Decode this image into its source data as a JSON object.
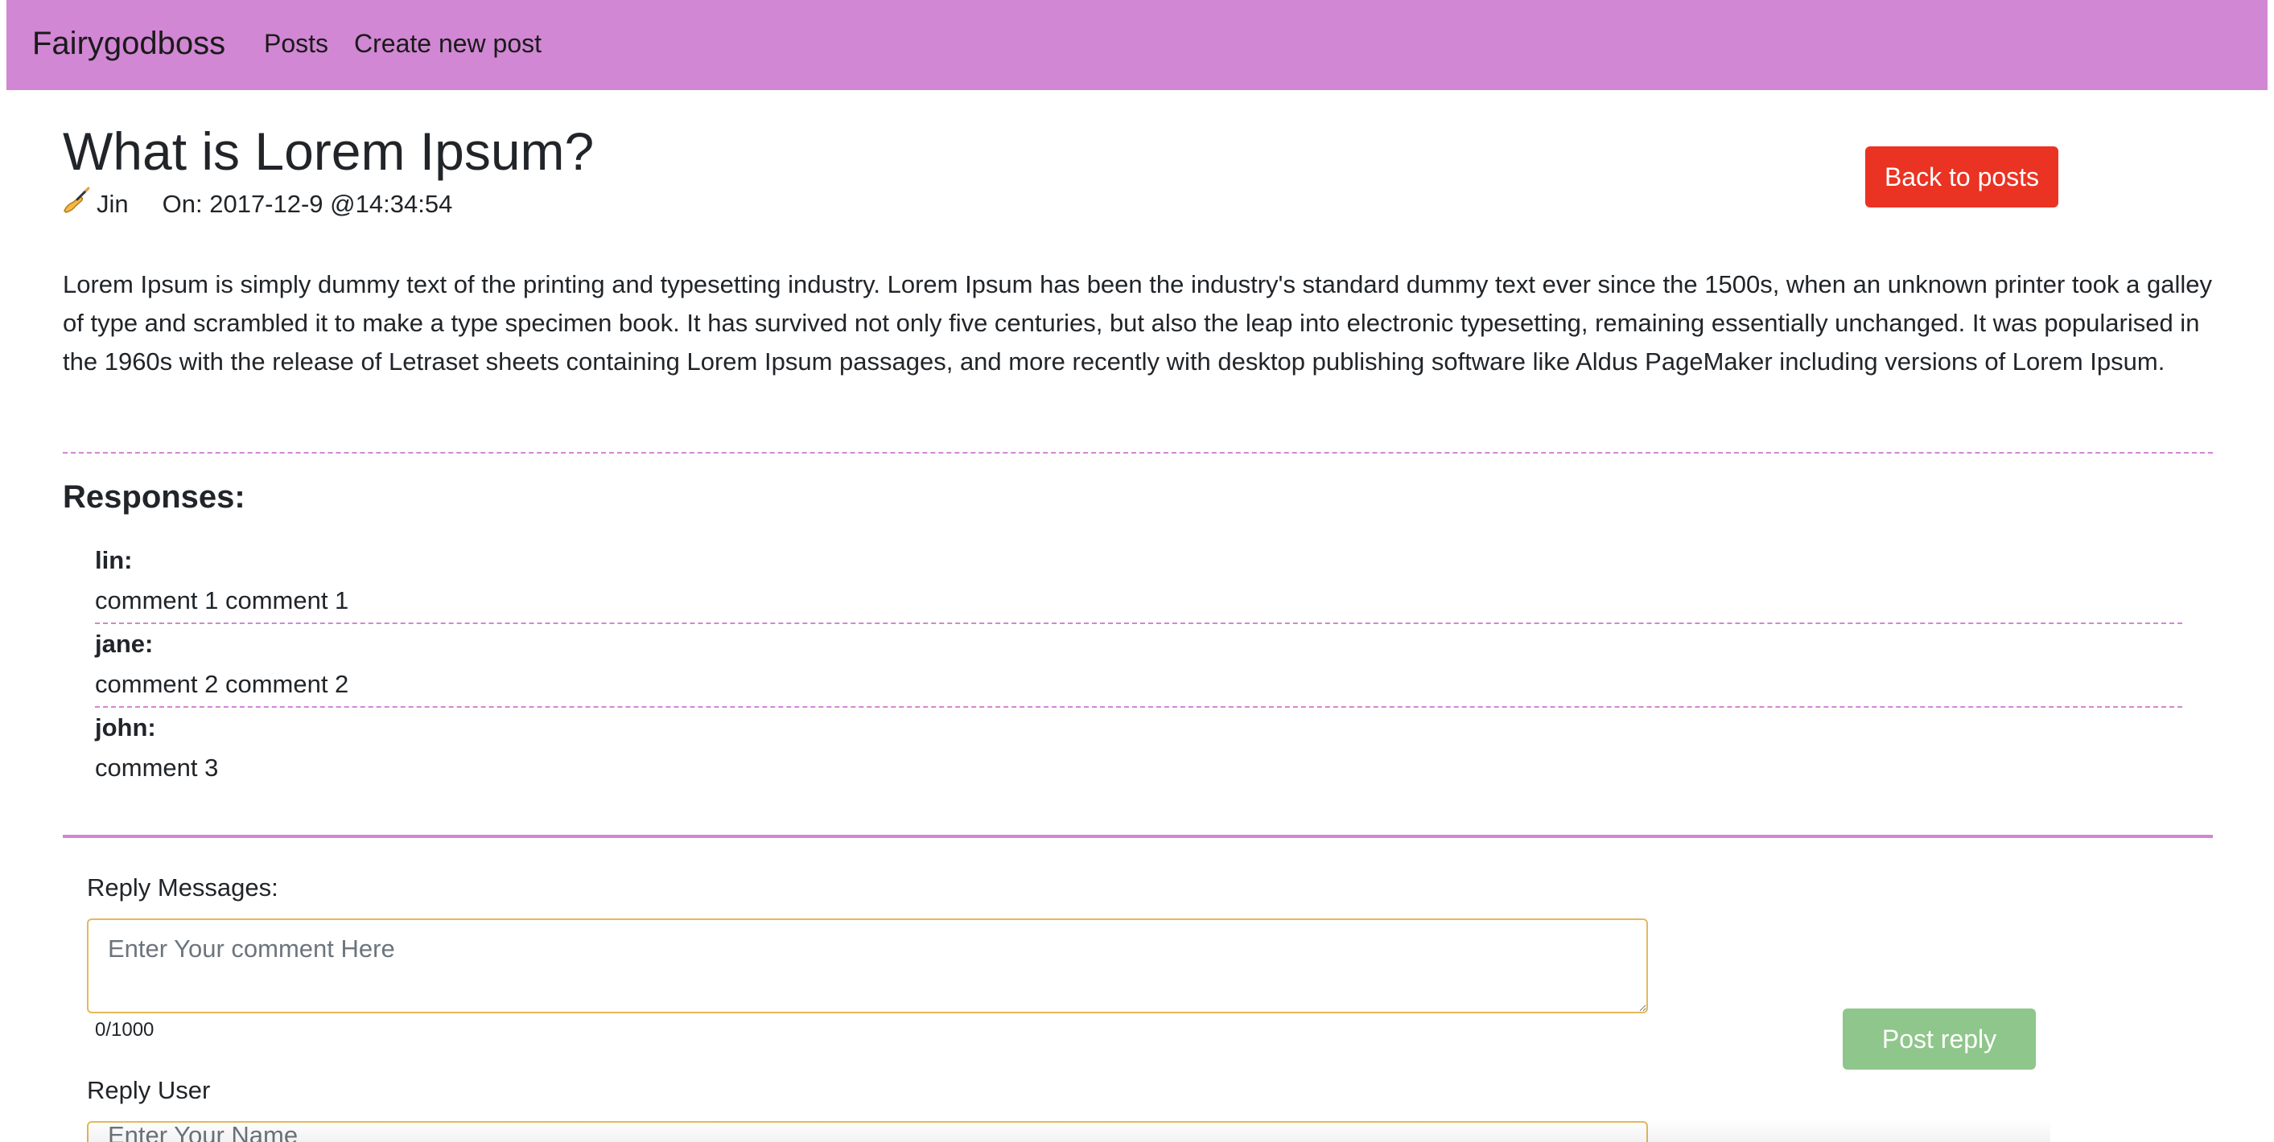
{
  "navbar": {
    "brand": "Fairygodboss",
    "links": [
      {
        "label": "Posts"
      },
      {
        "label": "Create new post"
      }
    ],
    "background": "#d187d3"
  },
  "post": {
    "title": "What is Lorem Ipsum?",
    "author_icon": "writing-hand-icon",
    "author": "Jin",
    "date": "On: 2017-12-9 @14:34:54",
    "body": "Lorem Ipsum is simply dummy text of the printing and typesetting industry. Lorem Ipsum has been the industry's standard dummy text ever since the 1500s, when an unknown printer took a galley of type and scrambled it to make a type specimen book. It has survived not only five centuries, but also the leap into electronic typesetting, remaining essentially unchanged. It was popularised in the 1960s with the release of Letraset sheets containing Lorem Ipsum passages, and more recently with desktop publishing software like Aldus PageMaker including versions of Lorem Ipsum."
  },
  "actions": {
    "back_label": "Back to posts",
    "back_color": "#ea3323"
  },
  "responses": {
    "heading": "Responses:",
    "items": [
      {
        "user": "lin:",
        "text": "comment 1 comment 1"
      },
      {
        "user": "jane:",
        "text": "comment 2 comment 2"
      },
      {
        "user": "john:",
        "text": "comment 3"
      }
    ]
  },
  "reply": {
    "messages_label": "Reply Messages:",
    "messages_value": "",
    "messages_placeholder": "Enter Your comment Here",
    "counter": "0/1000",
    "user_label": "Reply User",
    "user_value": "",
    "user_placeholder": "Enter Your Name",
    "post_label": "Post reply",
    "post_color": "#8fc68b"
  }
}
